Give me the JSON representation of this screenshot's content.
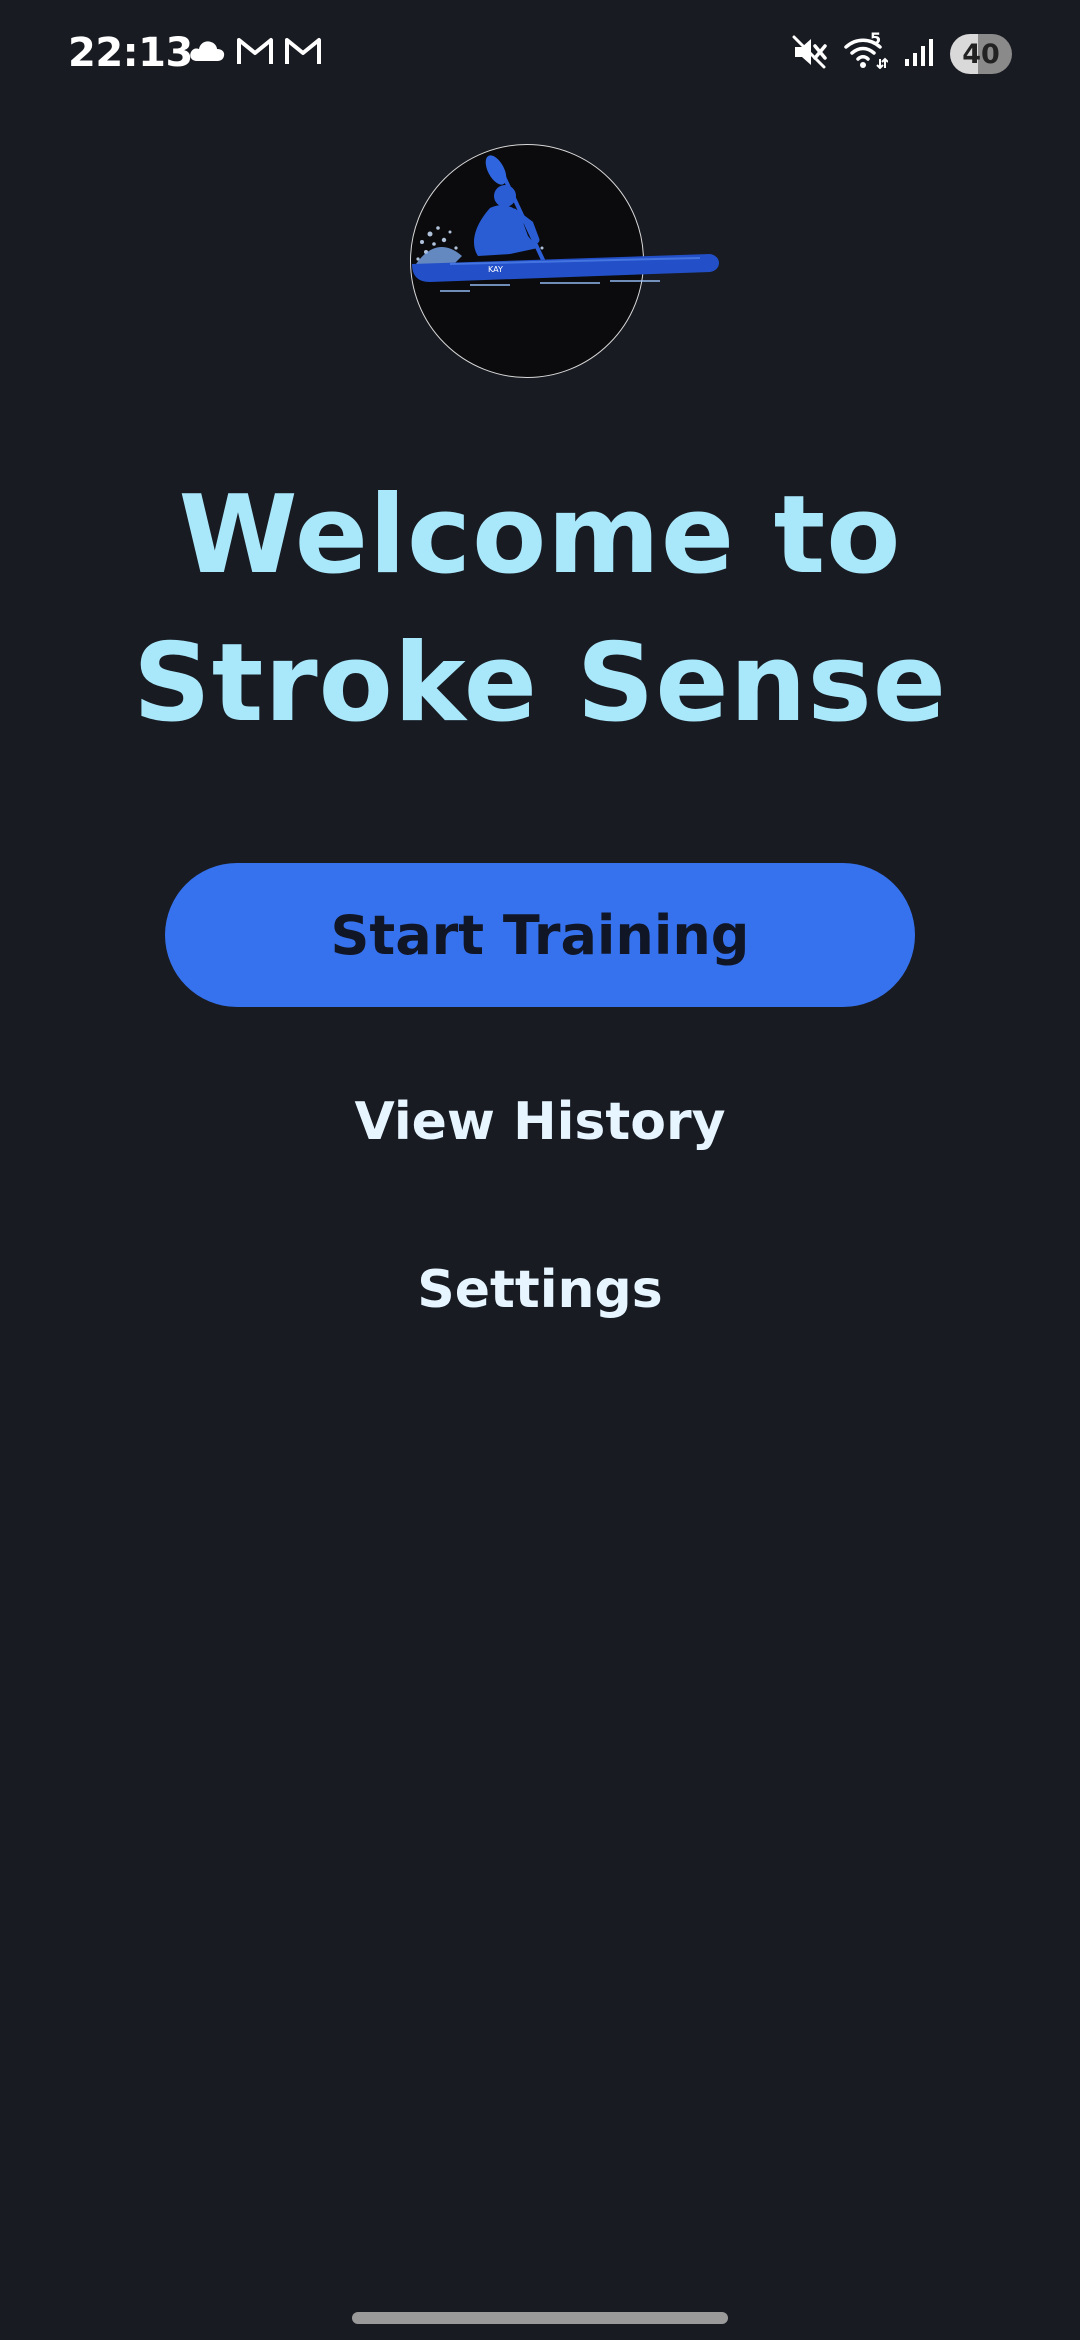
{
  "status_bar": {
    "time": "22:13",
    "left_icons": [
      "cloud-icon",
      "gmail-icon",
      "gmail-icon"
    ],
    "right_icons": [
      "mute-icon",
      "wifi-icon",
      "signal-icon"
    ],
    "wifi_badge": "5",
    "battery": "40"
  },
  "logo": {
    "icon": "kayaker-logo",
    "boat_text": "KAY"
  },
  "welcome": {
    "line1": "Welcome to",
    "line2": "Stroke Sense"
  },
  "menu": {
    "start_training": "Start Training",
    "view_history": "View History",
    "settings": "Settings"
  },
  "colors": {
    "background": "#181b22",
    "title": "#a9e7fb",
    "primary_button": "#3672ee",
    "primary_button_text": "#111626",
    "text_button": "#e6f5ff"
  }
}
